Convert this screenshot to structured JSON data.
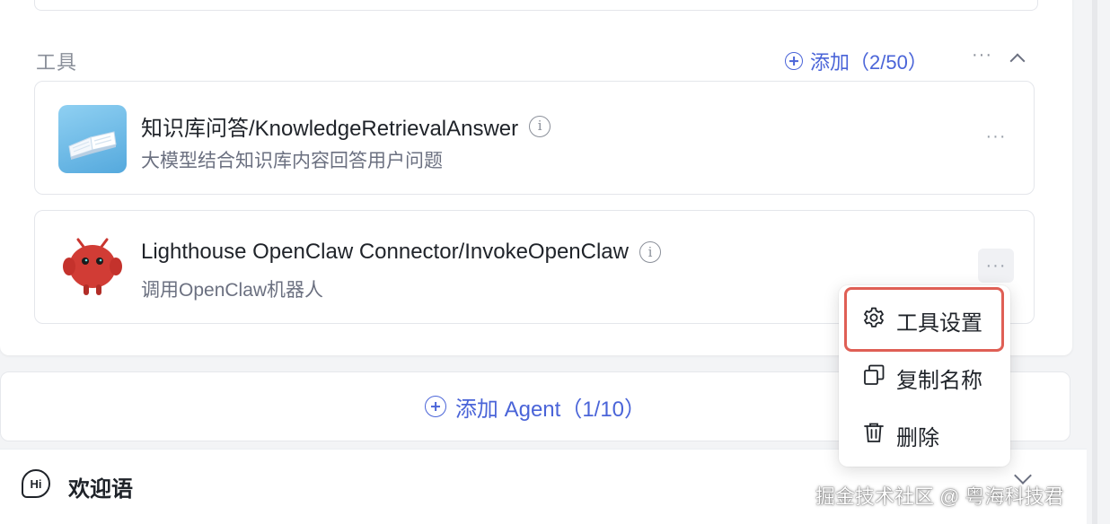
{
  "tools_section": {
    "title": "工具",
    "add_label": "添加（2/50）",
    "more_label": "···"
  },
  "tools": [
    {
      "name": "知识库问答/KnowledgeRetrievalAnswer",
      "description": "大模型结合知识库内容回答用户问题",
      "icon": "book-icon",
      "more_label": "···"
    },
    {
      "name": "Lighthouse OpenClaw Connector/InvokeOpenClaw",
      "description": "调用OpenClaw机器人",
      "icon": "red-mascot-icon",
      "more_label": "···"
    }
  ],
  "info_glyph": "i",
  "context_menu": {
    "items": [
      {
        "label": "工具设置",
        "icon": "gear-icon"
      },
      {
        "label": "复制名称",
        "icon": "copy-icon"
      },
      {
        "label": "删除",
        "icon": "trash-icon"
      }
    ],
    "highlight_color": "#df5f55"
  },
  "add_agent": {
    "label": "添加 Agent（1/10）"
  },
  "welcome": {
    "label": "欢迎语",
    "icon_text": "Hi"
  },
  "watermark": "掘金技术社区 @ 粤海科技君",
  "colors": {
    "accent": "#4a64d8",
    "muted": "#8a8f99"
  }
}
